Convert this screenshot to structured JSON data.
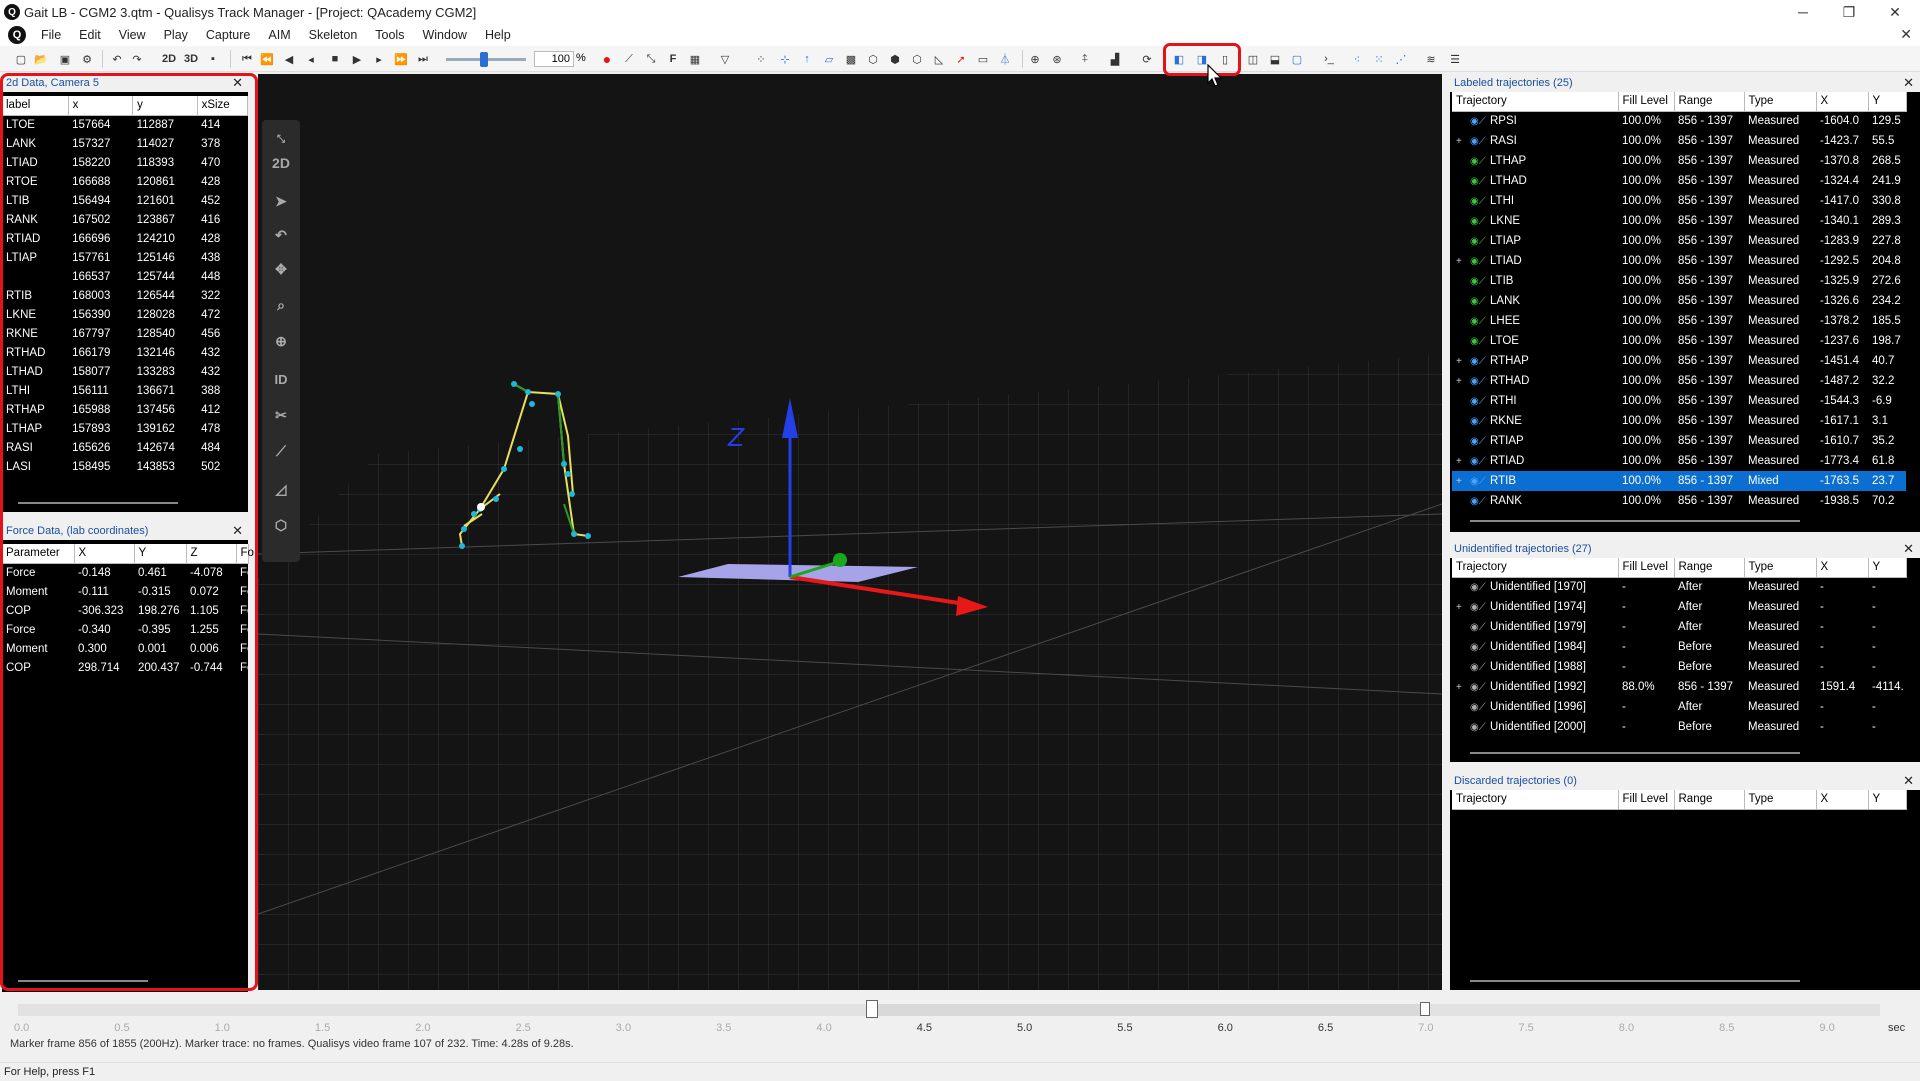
{
  "window": {
    "title": "Gait LB - CGM2 3.qtm - Qualisys Track Manager - [Project: QAcademy CGM2]"
  },
  "menu": [
    "File",
    "Edit",
    "View",
    "Play",
    "Capture",
    "AIM",
    "Skeleton",
    "Tools",
    "Window",
    "Help"
  ],
  "toolbar": {
    "zoom_value": "100",
    "zoom_unit": "%",
    "btn_2d": "2D",
    "btn_3d": "3D",
    "btn_f": "F"
  },
  "panel2d": {
    "title": "2d Data, Camera 5",
    "columns": [
      "label",
      "x",
      "y",
      "xSize"
    ],
    "rows": [
      [
        "LTOE",
        "157664",
        "112887",
        "414"
      ],
      [
        "LANK",
        "157327",
        "114027",
        "378"
      ],
      [
        "LTIAD",
        "158220",
        "118393",
        "470"
      ],
      [
        "RTOE",
        "166688",
        "120861",
        "428"
      ],
      [
        "LTIB",
        "156494",
        "121601",
        "452"
      ],
      [
        "RANK",
        "167502",
        "123867",
        "416"
      ],
      [
        "RTIAD",
        "166696",
        "124210",
        "428"
      ],
      [
        "LTIAP",
        "157761",
        "125146",
        "438"
      ],
      [
        "",
        "166537",
        "125744",
        "448"
      ],
      [
        "RTIB",
        "168003",
        "126544",
        "322"
      ],
      [
        "LKNE",
        "156390",
        "128028",
        "472"
      ],
      [
        "RKNE",
        "167797",
        "128540",
        "456"
      ],
      [
        "RTHAD",
        "166179",
        "132146",
        "432"
      ],
      [
        "LTHAD",
        "158077",
        "133283",
        "432"
      ],
      [
        "LTHI",
        "156111",
        "136671",
        "388"
      ],
      [
        "RTHAP",
        "165988",
        "137456",
        "412"
      ],
      [
        "LTHAP",
        "157893",
        "139162",
        "478"
      ],
      [
        "RASI",
        "165626",
        "142674",
        "484"
      ],
      [
        "LASI",
        "158495",
        "143853",
        "502"
      ]
    ]
  },
  "panelForce": {
    "title": "Force Data,  (lab coordinates)",
    "columns": [
      "Parameter",
      "X",
      "Y",
      "Z",
      "Fo"
    ],
    "rows": [
      [
        "Force",
        "-0.148",
        "0.461",
        "-4.078",
        "Fo"
      ],
      [
        "Moment",
        "-0.111",
        "-0.315",
        "0.072",
        "Fo"
      ],
      [
        "COP",
        "-306.323",
        "198.276",
        "1.105",
        "Fo"
      ],
      [
        "Force",
        "-0.340",
        "-0.395",
        "1.255",
        "Fo"
      ],
      [
        "Moment",
        "0.300",
        "0.001",
        "0.006",
        "Fo"
      ],
      [
        "COP",
        "298.714",
        "200.437",
        "-0.744",
        "Fo"
      ]
    ]
  },
  "view3d": {
    "axis_label": "Z",
    "tools": [
      "2D",
      "ID"
    ]
  },
  "labeled": {
    "title": "Labeled trajectories (25)",
    "columns": [
      "Trajectory",
      "Fill Level",
      "Range",
      "Type",
      "X",
      "Y"
    ],
    "rows": [
      {
        "exp": "",
        "name": "RPSI",
        "fill": "100.0%",
        "range": "856 - 1397",
        "type": "Measured",
        "x": "-1604.0",
        "y": "129.5",
        "c": "#4aa3ff"
      },
      {
        "exp": "+",
        "name": "RASI",
        "fill": "100.0%",
        "range": "856 - 1397",
        "type": "Measured",
        "x": "-1423.7",
        "y": "55.5",
        "c": "#4aa3ff"
      },
      {
        "exp": "",
        "name": "LTHAP",
        "fill": "100.0%",
        "range": "856 - 1397",
        "type": "Measured",
        "x": "-1370.8",
        "y": "268.5",
        "c": "#3ec43e"
      },
      {
        "exp": "",
        "name": "LTHAD",
        "fill": "100.0%",
        "range": "856 - 1397",
        "type": "Measured",
        "x": "-1324.4",
        "y": "241.9",
        "c": "#3ec43e"
      },
      {
        "exp": "",
        "name": "LTHI",
        "fill": "100.0%",
        "range": "856 - 1397",
        "type": "Measured",
        "x": "-1417.0",
        "y": "330.8",
        "c": "#3ec43e"
      },
      {
        "exp": "",
        "name": "LKNE",
        "fill": "100.0%",
        "range": "856 - 1397",
        "type": "Measured",
        "x": "-1340.1",
        "y": "289.3",
        "c": "#3ec43e"
      },
      {
        "exp": "",
        "name": "LTIAP",
        "fill": "100.0%",
        "range": "856 - 1397",
        "type": "Measured",
        "x": "-1283.9",
        "y": "227.8",
        "c": "#3ec43e"
      },
      {
        "exp": "+",
        "name": "LTIAD",
        "fill": "100.0%",
        "range": "856 - 1397",
        "type": "Measured",
        "x": "-1292.5",
        "y": "204.8",
        "c": "#3ec43e"
      },
      {
        "exp": "",
        "name": "LTIB",
        "fill": "100.0%",
        "range": "856 - 1397",
        "type": "Measured",
        "x": "-1325.9",
        "y": "272.6",
        "c": "#3ec43e"
      },
      {
        "exp": "",
        "name": "LANK",
        "fill": "100.0%",
        "range": "856 - 1397",
        "type": "Measured",
        "x": "-1326.6",
        "y": "234.2",
        "c": "#3ec43e"
      },
      {
        "exp": "",
        "name": "LHEE",
        "fill": "100.0%",
        "range": "856 - 1397",
        "type": "Measured",
        "x": "-1378.2",
        "y": "185.5",
        "c": "#3ec43e"
      },
      {
        "exp": "",
        "name": "LTOE",
        "fill": "100.0%",
        "range": "856 - 1397",
        "type": "Measured",
        "x": "-1237.6",
        "y": "198.7",
        "c": "#3ec43e"
      },
      {
        "exp": "+",
        "name": "RTHAP",
        "fill": "100.0%",
        "range": "856 - 1397",
        "type": "Measured",
        "x": "-1451.4",
        "y": "40.7",
        "c": "#4aa3ff"
      },
      {
        "exp": "+",
        "name": "RTHAD",
        "fill": "100.0%",
        "range": "856 - 1397",
        "type": "Measured",
        "x": "-1487.2",
        "y": "32.2",
        "c": "#4aa3ff"
      },
      {
        "exp": "",
        "name": "RTHI",
        "fill": "100.0%",
        "range": "856 - 1397",
        "type": "Measured",
        "x": "-1544.3",
        "y": "-6.9",
        "c": "#4aa3ff"
      },
      {
        "exp": "",
        "name": "RKNE",
        "fill": "100.0%",
        "range": "856 - 1397",
        "type": "Measured",
        "x": "-1617.1",
        "y": "3.1",
        "c": "#4aa3ff"
      },
      {
        "exp": "",
        "name": "RTIAP",
        "fill": "100.0%",
        "range": "856 - 1397",
        "type": "Measured",
        "x": "-1610.7",
        "y": "35.2",
        "c": "#4aa3ff"
      },
      {
        "exp": "+",
        "name": "RTIAD",
        "fill": "100.0%",
        "range": "856 - 1397",
        "type": "Measured",
        "x": "-1773.4",
        "y": "61.8",
        "c": "#4aa3ff"
      },
      {
        "exp": "+",
        "name": "RTIB",
        "fill": "100.0%",
        "range": "856 - 1397",
        "type": "Mixed",
        "x": "-1763.5",
        "y": "23.7",
        "c": "#4aa3ff",
        "sel": true
      },
      {
        "exp": "",
        "name": "RANK",
        "fill": "100.0%",
        "range": "856 - 1397",
        "type": "Measured",
        "x": "-1938.5",
        "y": "70.2",
        "c": "#4aa3ff"
      }
    ]
  },
  "unidentified": {
    "title": "Unidentified trajectories (27)",
    "columns": [
      "Trajectory",
      "Fill Level",
      "Range",
      "Type",
      "X",
      "Y"
    ],
    "rows": [
      {
        "exp": "",
        "name": "Unidentified [1970]",
        "fill": "-",
        "range": "After",
        "type": "Measured",
        "x": "-",
        "y": "-"
      },
      {
        "exp": "+",
        "name": "Unidentified [1974]",
        "fill": "-",
        "range": "After",
        "type": "Measured",
        "x": "-",
        "y": "-"
      },
      {
        "exp": "",
        "name": "Unidentified [1979]",
        "fill": "-",
        "range": "After",
        "type": "Measured",
        "x": "-",
        "y": "-"
      },
      {
        "exp": "",
        "name": "Unidentified [1984]",
        "fill": "-",
        "range": "Before",
        "type": "Measured",
        "x": "-",
        "y": "-"
      },
      {
        "exp": "",
        "name": "Unidentified [1988]",
        "fill": "-",
        "range": "Before",
        "type": "Measured",
        "x": "-",
        "y": "-"
      },
      {
        "exp": "+",
        "name": "Unidentified [1992]",
        "fill": "88.0%",
        "range": "856 - 1397",
        "type": "Measured",
        "x": "1591.4",
        "y": "-4114."
      },
      {
        "exp": "",
        "name": "Unidentified [1996]",
        "fill": "-",
        "range": "After",
        "type": "Measured",
        "x": "-",
        "y": "-"
      },
      {
        "exp": "",
        "name": "Unidentified [2000]",
        "fill": "-",
        "range": "Before",
        "type": "Measured",
        "x": "-",
        "y": "-"
      }
    ]
  },
  "discarded": {
    "title": "Discarded trajectories (0)",
    "columns": [
      "Trajectory",
      "Fill Level",
      "Range",
      "Type",
      "X",
      "Y"
    ]
  },
  "timeline": {
    "ticks": [
      "0.0",
      "0.5",
      "1.0",
      "1.5",
      "2.0",
      "2.5",
      "3.0",
      "3.5",
      "4.0",
      "4.5",
      "5.0",
      "5.5",
      "6.0",
      "6.5",
      "7.0",
      "7.5",
      "8.0",
      "8.5",
      "9.0"
    ],
    "active_from": 4.5,
    "active_to": 6.5,
    "unit": "sec",
    "info": "Marker frame 856 of 1855 (200Hz). Marker trace: no frames. Qualisys video frame 107 of 232. Time: 4.28s of 9.28s."
  },
  "status": "For Help, press F1"
}
